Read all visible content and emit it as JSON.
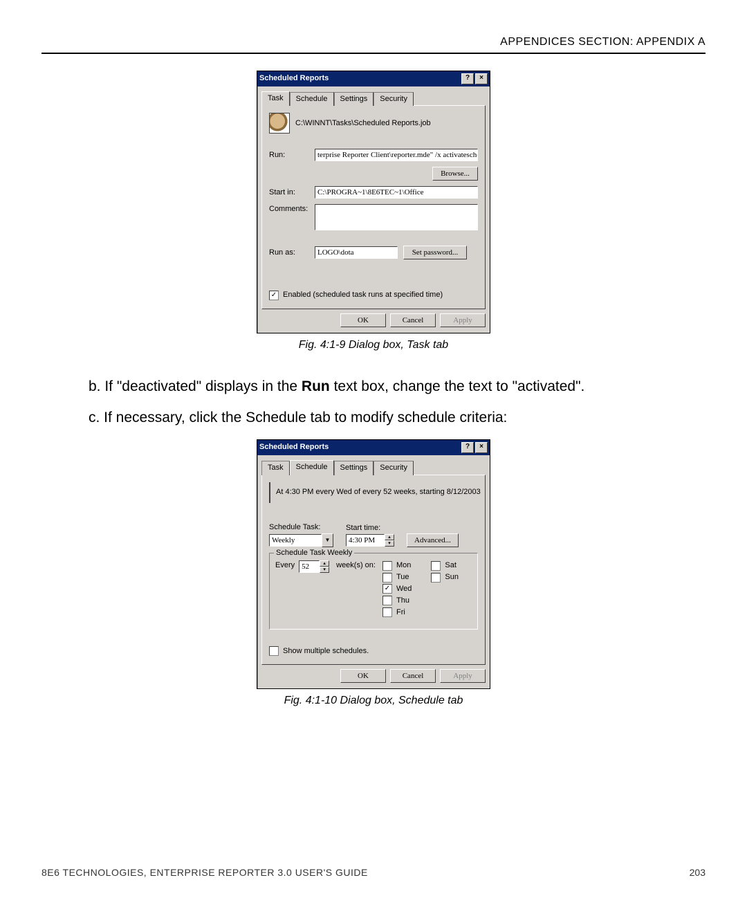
{
  "header": "APPENDICES SECTION: APPENDIX A",
  "footer_left": "8E6 TECHNOLOGIES, ENTERPRISE REPORTER 3.0 USER'S GUIDE",
  "footer_right": "203",
  "dlg1": {
    "title": "Scheduled Reports",
    "tabs": [
      "Task",
      "Schedule",
      "Settings",
      "Security"
    ],
    "path": "C:\\WINNT\\Tasks\\Scheduled Reports.job",
    "labels": {
      "run": "Run:",
      "startin": "Start in:",
      "comments": "Comments:",
      "runas": "Run as:"
    },
    "run_value": "terprise Reporter Client\\reporter.mde\" /x activateschedule",
    "browse": "Browse...",
    "startin_value": "C:\\PROGRA~1\\8E6TEC~1\\Office",
    "runas_value": "LOGO\\dota",
    "setpw": "Set password...",
    "enabled_label": "Enabled (scheduled task runs at specified time)",
    "buttons": {
      "ok": "OK",
      "cancel": "Cancel",
      "apply": "Apply"
    }
  },
  "caption1": "Fig. 4:1-9  Dialog box, Task tab",
  "para_b_pre": "b. If \"deactivated\" displays in the ",
  "para_b_bold": "Run",
  "para_b_post": " text box, change the text to \"activated\".",
  "para_c": "c. If necessary, click the Schedule tab to modify schedule criteria:",
  "dlg2": {
    "title": "Scheduled Reports",
    "tabs": [
      "Task",
      "Schedule",
      "Settings",
      "Security"
    ],
    "summary": "At 4:30 PM every Wed of every 52 weeks, starting 8/12/2003",
    "labels": {
      "schedule": "Schedule Task:",
      "starttime": "Start time:",
      "every": "Every",
      "weekson": "week(s) on:",
      "group": "Schedule Task Weekly"
    },
    "schedule_value": "Weekly",
    "starttime_value": "4:30 PM",
    "advanced": "Advanced...",
    "every_value": "52",
    "days": {
      "mon": "Mon",
      "tue": "Tue",
      "wed": "Wed",
      "thu": "Thu",
      "fri": "Fri",
      "sat": "Sat",
      "sun": "Sun"
    },
    "show_multiple": "Show multiple schedules.",
    "buttons": {
      "ok": "OK",
      "cancel": "Cancel",
      "apply": "Apply"
    }
  },
  "caption2": "Fig. 4:1-10  Dialog box, Schedule  tab"
}
